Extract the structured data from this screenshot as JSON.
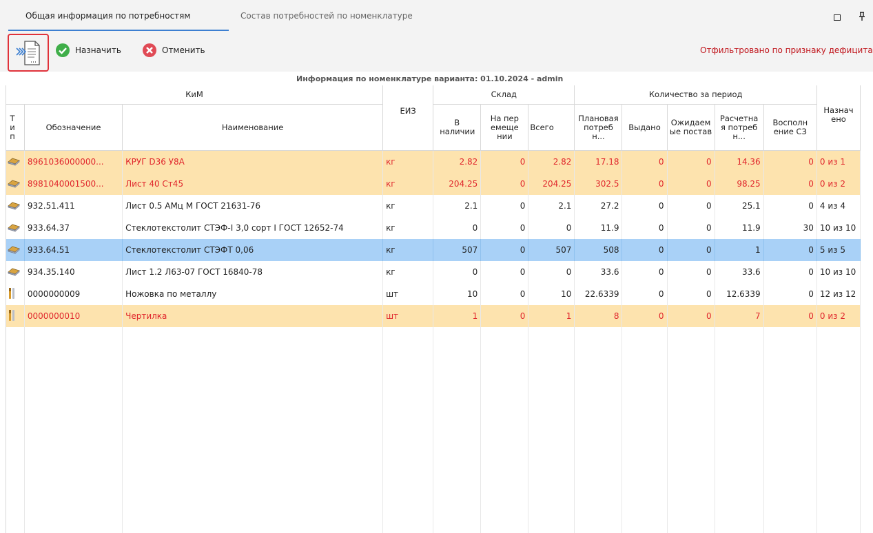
{
  "tabs": [
    {
      "label": "Общая информация по потребностям",
      "active": true
    },
    {
      "label": "Состав потребностей по номенклатуре",
      "active": false
    }
  ],
  "toolbar": {
    "assign_label": "Назначить",
    "cancel_label": "Отменить",
    "filter_note": "Отфильтровано по признаку дефицита"
  },
  "caption": "Информация по номенклатуре варианта: 01.10.2024 - admin",
  "headers": {
    "group_kim": "КиМ",
    "group_sklad": "Склад",
    "group_period": "Количество за период",
    "type": "Тип",
    "designation": "Обозначение",
    "name": "Наименование",
    "eiz": "ЕИЗ",
    "in_stock": "В наличии",
    "in_transit": "На перемещении",
    "total": "Всего",
    "planned": "Плановая потребн...",
    "issued": "Выдано",
    "expected": "Ожидаемые поставк...",
    "calculated": "Расчетная потребн...",
    "replenish": "Восполнение СЗ",
    "assigned": "Назначено"
  },
  "rows": [
    {
      "state": "deficit",
      "icon": "material-icon",
      "designation": "8961036000000...",
      "name": "КРУГ D36  У8А",
      "eiz": "кг",
      "in_stock": "2.82",
      "in_transit": "0",
      "total": "2.82",
      "planned": "17.18",
      "issued": "0",
      "expected": "0",
      "calculated": "14.36",
      "replenish": "0",
      "assigned": "0 из 1"
    },
    {
      "state": "deficit",
      "icon": "material-icon",
      "designation": "8981040001500...",
      "name": "Лист 40    Ст45",
      "eiz": "кг",
      "in_stock": "204.25",
      "in_transit": "0",
      "total": "204.25",
      "planned": "302.5",
      "issued": "0",
      "expected": "0",
      "calculated": "98.25",
      "replenish": "0",
      "assigned": "0 из 2"
    },
    {
      "state": "normal",
      "icon": "material-icon",
      "designation": "932.51.411",
      "name": "Лист 0.5   АМц М  ГОСТ 21631-76",
      "eiz": "кг",
      "in_stock": "2.1",
      "in_transit": "0",
      "total": "2.1",
      "planned": "27.2",
      "issued": "0",
      "expected": "0",
      "calculated": "25.1",
      "replenish": "0",
      "assigned": "4 из 4"
    },
    {
      "state": "normal",
      "icon": "material-icon",
      "designation": "933.64.37",
      "name": "Стеклотекстолит СТЭФ-I 3,0 сорт I ГОСТ 12652-74",
      "eiz": "кг",
      "in_stock": "0",
      "in_transit": "0",
      "total": "0",
      "planned": "11.9",
      "issued": "0",
      "expected": "0",
      "calculated": "11.9",
      "replenish": "30",
      "assigned": "10 из 10"
    },
    {
      "state": "selected",
      "icon": "material-icon",
      "designation": "933.64.51",
      "name": "Стеклотекстолит СТЭФТ 0,06",
      "eiz": "кг",
      "in_stock": "507",
      "in_transit": "0",
      "total": "507",
      "planned": "508",
      "issued": "0",
      "expected": "0",
      "calculated": "1",
      "replenish": "0",
      "assigned": "5 из 5"
    },
    {
      "state": "normal",
      "icon": "material-icon",
      "designation": "934.35.140",
      "name": "Лист 1.2   Л63-07 ГОСТ 16840-78",
      "eiz": "кг",
      "in_stock": "0",
      "in_transit": "0",
      "total": "0",
      "planned": "33.6",
      "issued": "0",
      "expected": "0",
      "calculated": "33.6",
      "replenish": "0",
      "assigned": "10 из 10"
    },
    {
      "state": "normal",
      "icon": "tool-icon",
      "designation": "0000000009",
      "name": "Ножовка по металлу",
      "eiz": "шт",
      "in_stock": "10",
      "in_transit": "0",
      "total": "10",
      "planned": "22.6339",
      "issued": "0",
      "expected": "0",
      "calculated": "12.6339",
      "replenish": "0",
      "assigned": "12 из 12"
    },
    {
      "state": "deficit",
      "icon": "tool-icon",
      "designation": "0000000010",
      "name": "Чертилка",
      "eiz": "шт",
      "in_stock": "1",
      "in_transit": "0",
      "total": "1",
      "planned": "8",
      "issued": "0",
      "expected": "0",
      "calculated": "7",
      "replenish": "0",
      "assigned": "0 из 2"
    }
  ],
  "colors": {
    "accent": "#3c7fd1",
    "deficit_bg": "#fde3ae",
    "deficit_text": "#e0262c",
    "selected_bg": "#a9d1f7",
    "highlight_border": "#e0323a"
  }
}
